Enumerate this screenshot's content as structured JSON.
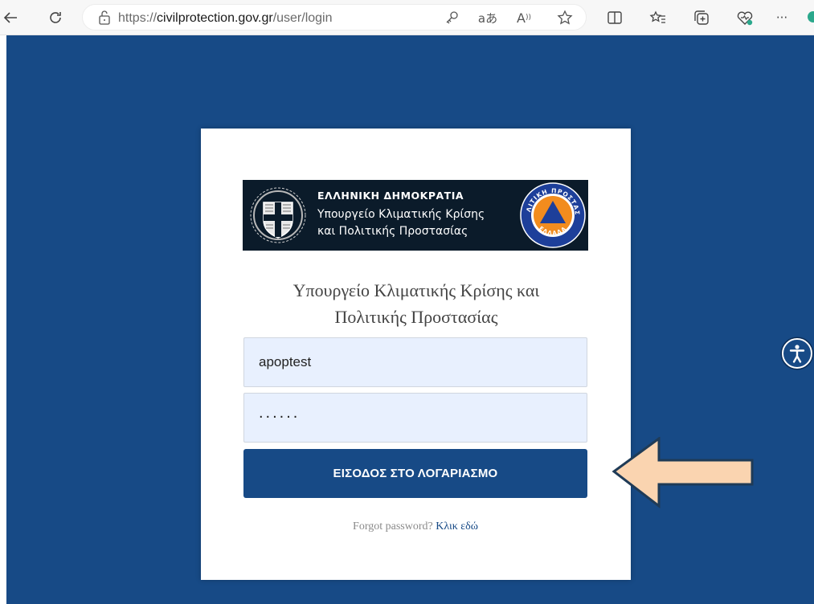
{
  "browser": {
    "url_prefix": "https://",
    "url_host": "civilprotection.gov.gr",
    "url_path": "/user/login",
    "icons": [
      "back-icon",
      "refresh-icon",
      "site-info-icon",
      "password-key-icon",
      "translate-icon",
      "read-aloud-icon",
      "favorite-star-icon",
      "split-screen-icon",
      "favorites-icon",
      "collections-icon",
      "browser-essentials-icon",
      "more-options-icon"
    ],
    "more_label": "···"
  },
  "banner": {
    "line1": "ΕΛΛΗΝΙΚΗ ΔΗΜΟΚΡΑΤΙΑ",
    "line2": "Υπουργείο Κλιματικής Κρίσης",
    "line3": "και Πολιτικής Προστασίας",
    "seal_text": "ΠΟΛΙΤΙΚΗ ΠΡΟΣΤΑΣΙΑ",
    "seal_bottom_text": "ΕΛΛΑΔΑ"
  },
  "login": {
    "ministry_line1": "Υπουργείο Κλιματικής Κρίσης και",
    "ministry_line2": "Πολιτικής Προστασίας",
    "username_value": "apoptest",
    "password_mask": "......",
    "submit_label": "ΕΙΣΟΔΟΣ ΣΤΟ ΛΟΓΑΡΙΑΣΜΟ",
    "forgot_text": "Forgot password?",
    "forgot_link": "Κλικ εδώ"
  },
  "colors": {
    "page_bg": "#174a86",
    "button_bg": "#174a86",
    "input_bg": "#e8f0fe",
    "banner_bg": "#0b1b2a",
    "arrow_fill": "#fad4b0",
    "arrow_stroke": "#1f3b57"
  }
}
